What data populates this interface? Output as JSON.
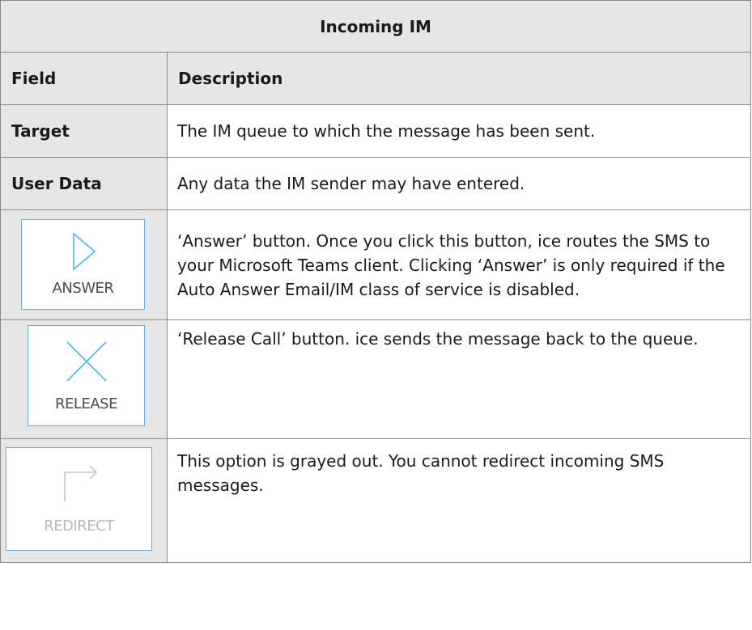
{
  "table": {
    "title": "Incoming IM",
    "headers": {
      "field": "Field",
      "description": "Description"
    },
    "rows": [
      {
        "field": "Target",
        "description": "The IM queue to which the message has been sent."
      },
      {
        "field": "User Data",
        "description": "Any data the IM sender may have entered."
      },
      {
        "icon": "play-icon",
        "button_label": "ANSWER",
        "description": "‘Answer’ button. Once you click this button, ice routes the SMS to your Microsoft Teams client. Clicking ‘Answer’ is only required if the Auto Answer Email/IM class of service is disabled."
      },
      {
        "icon": "close-icon",
        "button_label": "RELEASE",
        "description": "‘Release Call’ button. ice sends the message back to the queue."
      },
      {
        "icon": "redirect-arrow-icon",
        "button_label": "REDIRECT",
        "description": "This option is grayed out. You cannot redirect incoming SMS messages."
      }
    ]
  },
  "colors": {
    "header_bg": "#e6e6e6",
    "button_border": "#6fa9d8",
    "icon_accent": "#4fb3e8",
    "disabled_gray": "#b8b8b8"
  }
}
